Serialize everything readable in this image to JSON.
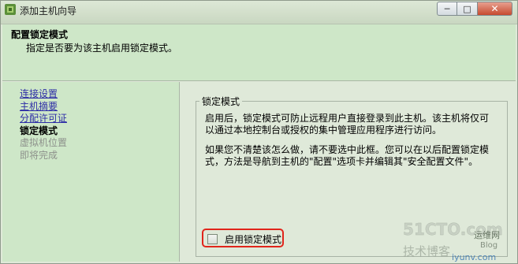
{
  "window": {
    "title": "添加主机向导",
    "buttons": {
      "minimize": "─",
      "maximize": "□",
      "close": "✕"
    }
  },
  "header": {
    "title": "配置锁定模式",
    "subtitle": "指定是否要为该主机启用锁定模式。"
  },
  "nav": {
    "items": [
      {
        "label": "连接设置",
        "state": "link"
      },
      {
        "label": "主机摘要",
        "state": "link"
      },
      {
        "label": "分配许可证",
        "state": "link"
      },
      {
        "label": "锁定模式",
        "state": "current"
      },
      {
        "label": "虚拟机位置",
        "state": "disabled"
      },
      {
        "label": "即将完成",
        "state": "disabled"
      }
    ]
  },
  "lockdown": {
    "group_title": "锁定模式",
    "paragraph1": "启用后，锁定模式可防止远程用户直接登录到此主机。该主机将仅可以通过本地控制台或授权的集中管理应用程序进行访问。",
    "paragraph2": "如果您不清楚该怎么做，请不要选中此框。您可以在以后配置锁定模式，方法是导航到主机的\"配置\"选项卡并编辑其\"安全配置文件\"。",
    "checkbox_label": "启用锁定模式",
    "checkbox_checked": false
  },
  "watermark": {
    "site": "51CTO.com",
    "line2": "技术博客",
    "line3": "Blog",
    "line4": "运维网",
    "line5": "iyunv.com"
  },
  "colors": {
    "panel_bg": "#cee7c8",
    "window_bg": "#dfe9d9",
    "link": "#2d2da6",
    "highlight": "#e1251b"
  }
}
